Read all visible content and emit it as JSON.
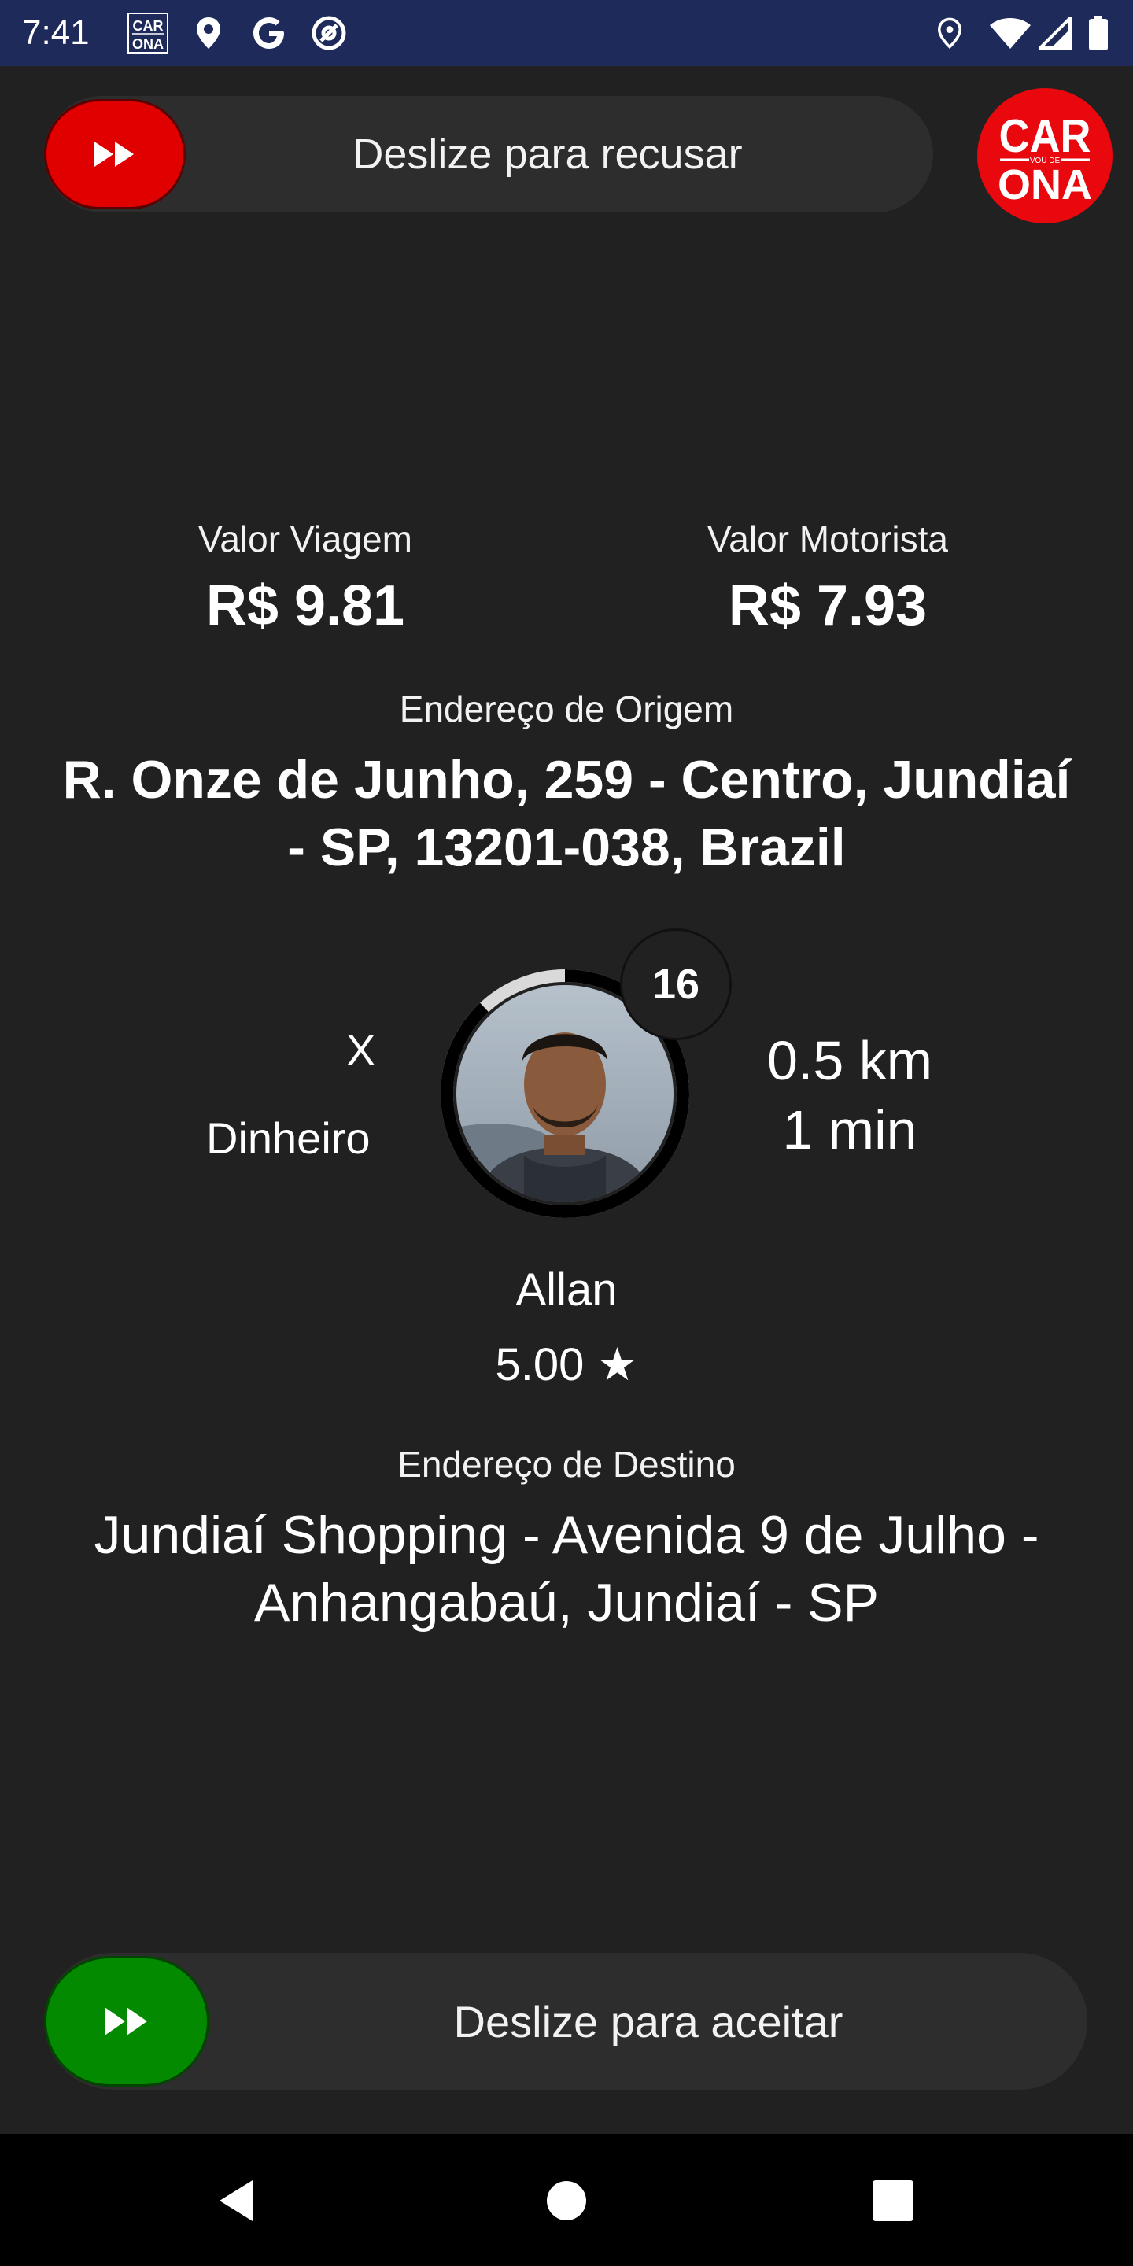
{
  "status_bar": {
    "time": "7:41",
    "left_icons": [
      "carona-app-icon",
      "location-pin-icon",
      "google-icon",
      "at-sign-icon"
    ],
    "right_icons": [
      "location-pin-icon",
      "wifi-icon",
      "signal-icon",
      "battery-icon"
    ],
    "mini_logo_top": "CAR",
    "mini_logo_bottom": "ONA"
  },
  "refuse_slider": {
    "label": "Deslize para recusar",
    "color": "#e00000"
  },
  "logo": {
    "top": "CAR",
    "middle": "VOU DE",
    "bottom": "ONA",
    "color": "#e8080e"
  },
  "fare": {
    "trip_label": "Valor Viagem",
    "trip_value": "R$ 9.81",
    "driver_label": "Valor Motorista",
    "driver_value": "R$ 7.93"
  },
  "origin": {
    "label": "Endereço de Origem",
    "address_line1": "R. Onze de Junho, 259 - Centro, Jundiaí",
    "address_line2": "- SP, 13201-038, Brazil"
  },
  "passenger": {
    "category": "X",
    "payment": "Dinheiro",
    "countdown": "16",
    "countdown_progress": 0.88,
    "name": "Allan",
    "rating": "5.00 ★",
    "distance": "0.5 km",
    "eta": "1 min"
  },
  "destination": {
    "label": "Endereço de Destino",
    "address_line1": "Jundiaí Shopping - Avenida 9 de Julho -",
    "address_line2": "Anhangabaú, Jundiaí - SP"
  },
  "accept_slider": {
    "label": "Deslize para aceitar",
    "color": "#048a00"
  },
  "nav_bar": {
    "icons": [
      "back-icon",
      "home-icon",
      "recents-icon"
    ]
  }
}
